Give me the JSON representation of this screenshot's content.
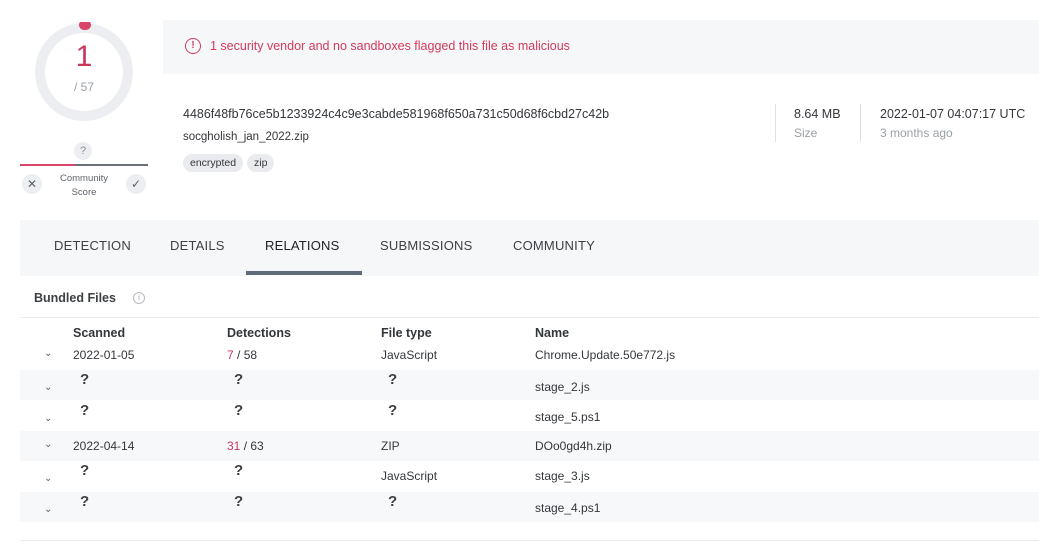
{
  "score": {
    "detected": "1",
    "total": "/ 57",
    "community_label": "Community Score",
    "community_unknown": "?",
    "community_fraction": 0.43,
    "accent": "#d9466b"
  },
  "alert": {
    "icon": "alert-circle-icon",
    "text": "1 security vendor and no sandboxes flagged this file as malicious"
  },
  "file": {
    "hash": "4486f48fb76ce5b1233924c4c9e3cabde581968f650a731c50d68f6cbd27c42b",
    "name": "socgholish_jan_2022.zip",
    "tags": [
      "encrypted",
      "zip"
    ],
    "size_value": "8.64 MB",
    "size_label": "Size",
    "date_value": "2022-01-07 04:07:17 UTC",
    "date_relative": "3 months ago"
  },
  "tabs": [
    "DETECTION",
    "DETAILS",
    "RELATIONS",
    "SUBMISSIONS",
    "COMMUNITY"
  ],
  "active_tab": "RELATIONS",
  "bundled": {
    "title": "Bundled Files",
    "headers": [
      "Scanned",
      "Detections",
      "File type",
      "Name"
    ],
    "rows": [
      {
        "scanned": "2022-01-05",
        "det": "7",
        "det_total": "/ 58",
        "type": "JavaScript",
        "name": "Chrome.Update.50e772.js"
      },
      {
        "scanned": "?",
        "det": "?",
        "det_total": "",
        "type": "?",
        "name": "stage_2.js"
      },
      {
        "scanned": "?",
        "det": "?",
        "det_total": "",
        "type": "?",
        "name": "stage_5.ps1"
      },
      {
        "scanned": "2022-04-14",
        "det": "31",
        "det_total": "/ 63",
        "type": "ZIP",
        "name": "DOo0gd4h.zip"
      },
      {
        "scanned": "?",
        "det": "?",
        "det_total": "",
        "type": "JavaScript",
        "name": "stage_3.js"
      },
      {
        "scanned": "?",
        "det": "?",
        "det_total": "",
        "type": "?",
        "name": "stage_4.ps1"
      }
    ]
  }
}
